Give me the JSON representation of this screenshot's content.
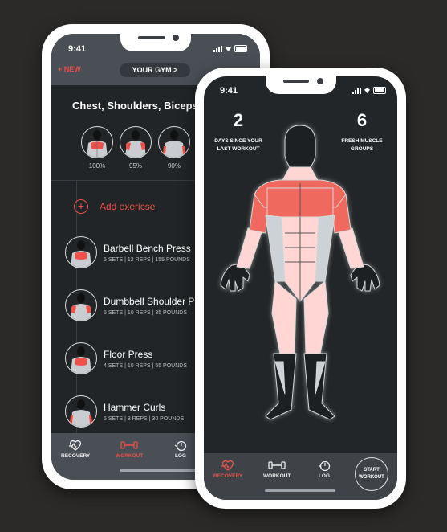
{
  "back_phone": {
    "status_time": "9:41",
    "header": {
      "new_label": "+ NEW",
      "gym_label": "YOUR GYM >"
    },
    "workout_title": "Chest, Shoulders, Biceps",
    "muscle_groups": [
      {
        "muscle": "chest",
        "percent": "100%"
      },
      {
        "muscle": "shoulders",
        "percent": "95%"
      },
      {
        "muscle": "biceps",
        "percent": "90%"
      }
    ],
    "add_exercise_label": "Add exericse",
    "exercises": [
      {
        "name": "Barbell Bench Press",
        "meta": "5 SETS  |  12 REPS  |  155 POUNDS",
        "muscle": "chest"
      },
      {
        "name": "Dumbbell Shoulder Press",
        "meta": "5 SETS  |  10 REPS  |  35 POUNDS",
        "muscle": "shoulders"
      },
      {
        "name": "Floor Press",
        "meta": "4 SETS  |  10 REPS  |  55 POUNDS",
        "muscle": "chest"
      },
      {
        "name": "Hammer Curls",
        "meta": "5 SETS  |  8 REPS  |  30 POUNDS",
        "muscle": "biceps"
      }
    ],
    "tabs": [
      {
        "label": "RECOVERY",
        "icon": "heart-pulse-icon",
        "active": false
      },
      {
        "label": "WORKOUT",
        "icon": "dumbbell-icon",
        "active": true
      },
      {
        "label": "LOG",
        "icon": "stopwatch-icon",
        "active": false
      }
    ]
  },
  "front_phone": {
    "status_time": "9:41",
    "stats": [
      {
        "value": "2",
        "label_line1": "DAYS SINCE YOUR",
        "label_line2": "LAST WORKOUT"
      },
      {
        "value": "6",
        "label_line1": "FRESH MUSCLE",
        "label_line2": "GROUPS"
      }
    ],
    "tabs": [
      {
        "label": "RECOVERY",
        "icon": "heart-pulse-icon",
        "active": true
      },
      {
        "label": "WORKOUT",
        "icon": "dumbbell-icon",
        "active": false
      },
      {
        "label": "LOG",
        "icon": "stopwatch-icon",
        "active": false
      }
    ],
    "start_button": {
      "line1": "START",
      "line2": "WORKOUT"
    }
  },
  "colors": {
    "accent": "#e8504a",
    "background": "#2b2a28",
    "screen": "#232628",
    "bar": "#4a4f55",
    "muscle_fresh": "#ffd6d4",
    "muscle_worked": "#f0695f",
    "muscle_neutral": "#cdd2d6"
  }
}
